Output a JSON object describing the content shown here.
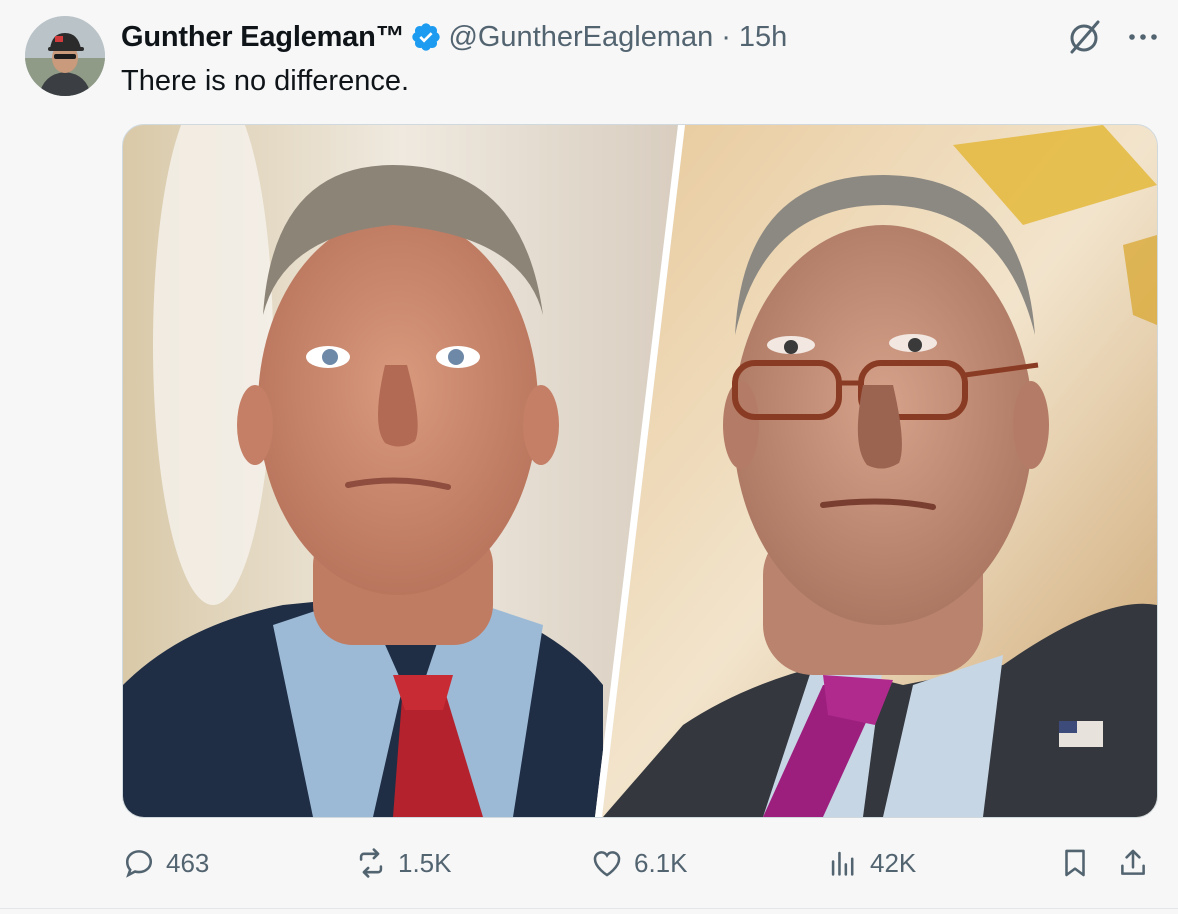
{
  "tweet": {
    "author": {
      "display_name": "Gunther Eagleman™",
      "handle": "@GuntherEagleman",
      "avatar_icon": "avatar-man-cap",
      "verified_color": "#1d9bf0"
    },
    "separator": "·",
    "time": "15h",
    "text": "There is no difference.",
    "media": {
      "left_photo": "man-in-navy-suit-red-tie",
      "right_photo": "man-with-glasses-purple-tie-flag-pin"
    },
    "stats": {
      "replies": "463",
      "reposts": "1.5K",
      "likes": "6.1K",
      "views": "42K"
    },
    "icons": {
      "grok": "grok-icon",
      "more": "more-icon",
      "reply": "reply-icon",
      "repost": "repost-icon",
      "like": "heart-icon",
      "views": "views-icon",
      "bookmark": "bookmark-icon",
      "share": "share-icon"
    },
    "colors": {
      "text": "#0f1419",
      "secondary": "#536471",
      "border": "#cfd9de",
      "background": "#f7f7f7"
    }
  }
}
